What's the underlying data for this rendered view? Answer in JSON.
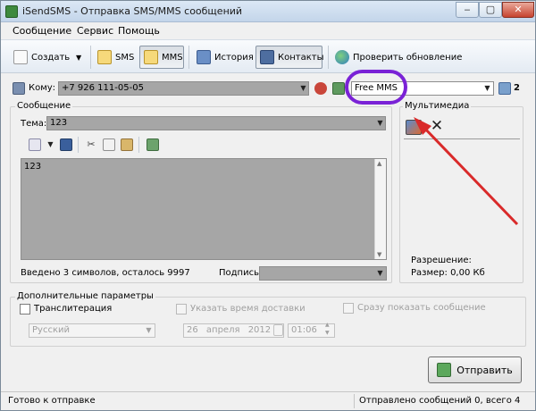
{
  "window": {
    "title": "iSendSMS - Отправка SMS/MMS сообщений"
  },
  "menu": [
    "Сообщение",
    "Сервис",
    "Помощь"
  ],
  "toolbar": {
    "create": "Создать",
    "sms": "SMS",
    "mms": "MMS",
    "history": "История",
    "contacts": "Контакты",
    "update": "Проверить обновление"
  },
  "recipient": {
    "label": "Кому:",
    "value": "+7 926 111-05-05",
    "service": "Free MMS",
    "count": "2"
  },
  "message": {
    "group_label": "Сообщение",
    "subject_label": "Тема:",
    "subject_value": "123",
    "body": "123",
    "counter": "Введено 3 символов, осталось 9997",
    "signature_label": "Подпись"
  },
  "multimedia": {
    "label": "Мультимедиа",
    "resolution": "Разрешение:",
    "size": "Размер: 0,00 Кб"
  },
  "extra": {
    "label": "Дополнительные параметры",
    "translit": "Транслитерация",
    "language": "Русский",
    "delivery_time": "Указать время доставки",
    "date_day": "26",
    "date_month": "апреля",
    "date_year": "2012",
    "time": "01:06",
    "show_now": "Сразу показать сообщение"
  },
  "send": {
    "label": "Отправить"
  },
  "status": {
    "left": "Готово к отправке",
    "right": "Отправлено сообщений 0, всего 4"
  },
  "colors": {
    "highlight": "#7a22d6",
    "arrow": "#d92a2a"
  }
}
